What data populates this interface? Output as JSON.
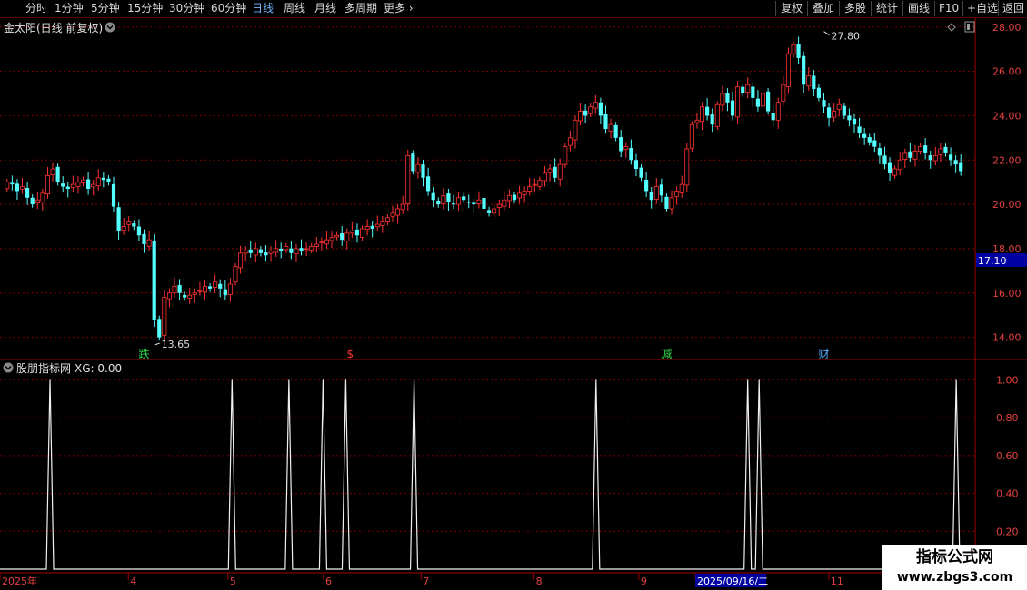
{
  "toolbar": {
    "left_items": [
      "分时",
      "1分钟",
      "5分钟",
      "15分钟",
      "30分钟",
      "60分钟",
      "日线",
      "周线",
      "月线",
      "多周期",
      "更多"
    ],
    "active_item": "日线",
    "right_items": [
      "复权",
      "叠加",
      "多股",
      "统计",
      "画线",
      "F10",
      "+自选",
      "返回"
    ]
  },
  "main_title": "金太阳(日线 前复权)",
  "indicator_title": "股朋指标网",
  "indicator_value": "XG: 0.00",
  "price_tag": "17.10",
  "watermark": {
    "title": "指标公式网",
    "url": "www.zbgs3.com"
  },
  "colors": {
    "up": "#ff3232",
    "down": "#54ffff",
    "grid": "#7a0000",
    "axis_text": "#e04040",
    "blue_tag": "#0000a0"
  },
  "chart_data": [
    {
      "type": "candlestick",
      "ylim": [
        13.0,
        28.4
      ],
      "yticks": [
        14.0,
        16.0,
        18.0,
        20.0,
        22.0,
        24.0,
        26.0,
        28.0
      ],
      "ytick_labels": [
        "14.00",
        "16.00",
        "18.00",
        "20.00",
        "22.00",
        "24.00",
        "26.00",
        "28.00"
      ],
      "annotations": [
        {
          "text": "27.80",
          "value": 27.8,
          "bar": 161
        },
        {
          "text": "13.65",
          "value": 13.65,
          "bar": 29
        }
      ],
      "signals": [
        {
          "text": "跌",
          "bar": 27,
          "color": "#2fd34a"
        },
        {
          "text": "$",
          "bar": 68,
          "color": "#ff3030"
        },
        {
          "text": "减",
          "bar": 130,
          "color": "#2fd34a"
        },
        {
          "text": "财",
          "bar": 161,
          "color": "#55aaff"
        }
      ],
      "closes": [
        21.0,
        20.9,
        20.6,
        20.8,
        20.3,
        20.0,
        20.2,
        20.5,
        21.3,
        21.6,
        21.0,
        20.8,
        20.7,
        20.9,
        21.0,
        21.1,
        20.7,
        20.9,
        21.2,
        21.1,
        21.0,
        19.9,
        18.8,
        19.0,
        19.2,
        19.0,
        18.6,
        18.2,
        18.4,
        14.8,
        14.0,
        15.8,
        16.0,
        16.3,
        16.0,
        15.8,
        15.9,
        16.0,
        16.1,
        16.3,
        16.2,
        16.5,
        16.2,
        15.9,
        16.4,
        17.2,
        17.8,
        17.9,
        17.8,
        18.0,
        17.8,
        17.7,
        17.9,
        18.0,
        17.9,
        18.1,
        17.8,
        18.0,
        17.9,
        18.0,
        18.1,
        18.2,
        18.3,
        18.4,
        18.5,
        18.6,
        18.4,
        18.7,
        18.8,
        18.6,
        18.9,
        19.0,
        18.9,
        19.1,
        19.2,
        19.4,
        19.6,
        19.8,
        20.0,
        22.2,
        21.5,
        21.8,
        21.2,
        20.6,
        20.2,
        20.0,
        20.4,
        20.1,
        20.0,
        20.3,
        20.2,
        20.1,
        20.0,
        20.2,
        19.8,
        19.6,
        19.8,
        20.0,
        20.2,
        20.4,
        20.2,
        20.5,
        20.6,
        20.8,
        20.9,
        21.1,
        21.4,
        21.6,
        21.2,
        21.8,
        22.6,
        23.0,
        23.8,
        24.2,
        24.0,
        24.4,
        24.6,
        24.0,
        23.4,
        23.6,
        23.0,
        22.4,
        22.6,
        22.0,
        21.6,
        21.2,
        20.6,
        20.2,
        20.8,
        20.4,
        19.8,
        20.3,
        20.6,
        20.9,
        22.5,
        23.6,
        23.8,
        24.4,
        24.0,
        23.6,
        24.5,
        25.0,
        24.6,
        24.0,
        25.3,
        25.0,
        25.4,
        24.8,
        24.4,
        25.0,
        24.2,
        23.8,
        24.6,
        25.4,
        26.8,
        27.2,
        26.6,
        25.4,
        25.8,
        25.2,
        24.8,
        24.4,
        23.9,
        24.2,
        24.5,
        24.0,
        23.8,
        23.6,
        23.2,
        23.0,
        22.8,
        22.6,
        22.2,
        21.8,
        21.4,
        21.6,
        22.0,
        22.3,
        22.1,
        22.4,
        22.6,
        22.3,
        22.0,
        22.2,
        22.5,
        22.3,
        22.0,
        21.8,
        21.5
      ],
      "current_price": 17.1
    },
    {
      "type": "line",
      "series": [
        {
          "name": "XG",
          "x": [
            6,
            54,
            69,
            78,
            84,
            102,
            150,
            190,
            193,
            245
          ],
          "values": [
            1,
            1,
            1,
            1,
            1,
            1,
            1,
            1,
            1,
            1
          ]
        }
      ],
      "ylim": [
        0,
        1.05
      ],
      "yticks": [
        0.2,
        0.4,
        0.6,
        0.8,
        1.0
      ],
      "ytick_labels": [
        "0.20",
        "0.40",
        "0.60",
        "0.80",
        "1.00"
      ],
      "x_labels": [
        {
          "text": "2025年",
          "pos": 0.0
        },
        {
          "text": "4",
          "pos": 0.125
        },
        {
          "text": "5",
          "pos": 0.222
        },
        {
          "text": "6",
          "pos": 0.315
        },
        {
          "text": "7",
          "pos": 0.41
        },
        {
          "text": "8",
          "pos": 0.52
        },
        {
          "text": "9",
          "pos": 0.622
        },
        {
          "text": "2025/09/16/二",
          "pos": 0.677,
          "highlight": true
        },
        {
          "text": "11",
          "pos": 0.807
        }
      ]
    }
  ]
}
